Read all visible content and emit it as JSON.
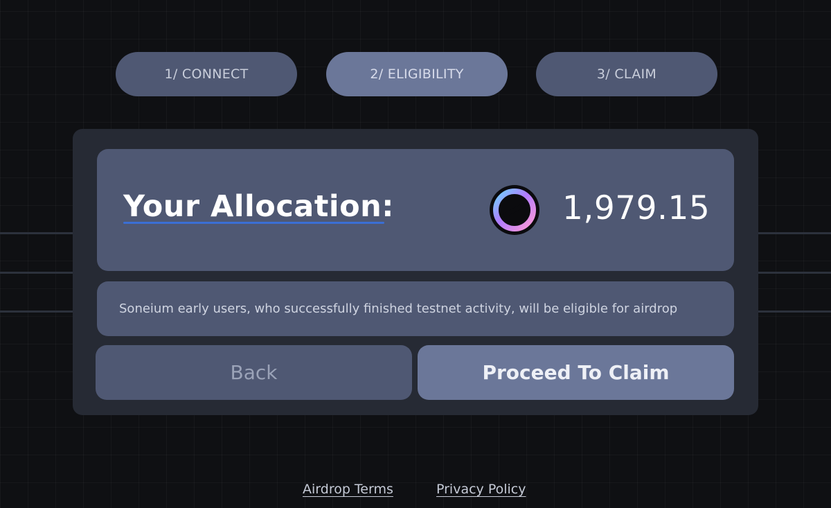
{
  "steps": [
    {
      "label": "1/ CONNECT",
      "active": false
    },
    {
      "label": "2/ ELIGIBILITY",
      "active": true
    },
    {
      "label": "3/ CLAIM",
      "active": false
    }
  ],
  "allocation": {
    "label": "Your Allocation:",
    "amount": "1,979.15",
    "token_icon": "soneium-token-icon"
  },
  "info": {
    "text": "Soneium early users, who successfully finished testnet activity, will be eligible for airdrop"
  },
  "actions": {
    "back_label": "Back",
    "proceed_label": "Proceed To Claim"
  },
  "footer": {
    "links": [
      "Airdrop Terms",
      "Privacy Policy"
    ]
  },
  "colors": {
    "background": "#0f1013",
    "card": "#262a34",
    "panel": "#4f5873",
    "active": "#6b7799",
    "accent_underline": "#3b6fd4"
  }
}
